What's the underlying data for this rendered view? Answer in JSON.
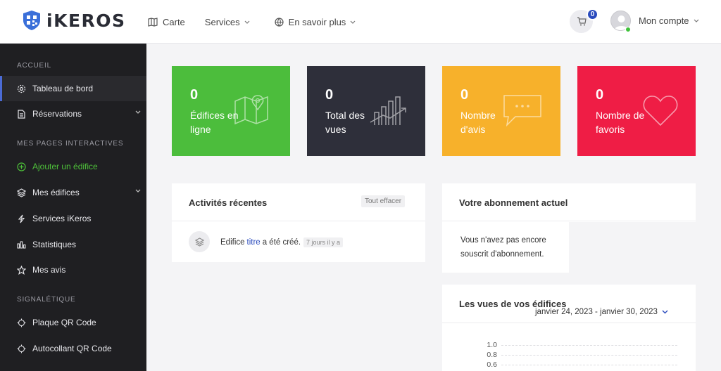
{
  "header": {
    "logo_text": "iKEROS",
    "nav": [
      {
        "label": "Carte",
        "icon": "map-icon"
      },
      {
        "label": "Services",
        "icon": ""
      },
      {
        "label": "En savoir plus",
        "icon": "globe-icon"
      }
    ],
    "cart_count": "0",
    "account_label": "Mon compte"
  },
  "sidebar": {
    "sections": [
      "ACCUEIL",
      "MES PAGES INTERACTIVES",
      "SIGNALÉTIQUE"
    ],
    "items": [
      {
        "label": "Tableau de bord",
        "icon": "gear-icon"
      },
      {
        "label": "Réservations",
        "icon": "document-icon"
      },
      {
        "label": "Ajouter un édifice",
        "icon": "plus-circle-icon"
      },
      {
        "label": "Mes édifices",
        "icon": "layers-icon"
      },
      {
        "label": "Services iKeros",
        "icon": "bolt-icon"
      },
      {
        "label": "Statistiques",
        "icon": "bar-chart-icon"
      },
      {
        "label": "Mes avis",
        "icon": "star-icon"
      },
      {
        "label": "Plaque QR Code",
        "icon": "crosshair-icon"
      },
      {
        "label": "Autocollant QR Code",
        "icon": "crosshair-icon"
      }
    ]
  },
  "cards": [
    {
      "value": "0",
      "label": "Édifices en ligne",
      "color": "#4cbd3c",
      "icon": "map-pin-icon"
    },
    {
      "value": "0",
      "label": "Total des vues",
      "color": "#2e2f3a",
      "icon": "growth-chart-icon"
    },
    {
      "value": "0",
      "label": "Nombre d'avis",
      "color": "#f7b12b",
      "icon": "speech-bubble-icon"
    },
    {
      "value": "0",
      "label": "Nombre de favoris",
      "color": "#ef1d45",
      "icon": "heart-icon"
    }
  ],
  "activities": {
    "title": "Activités récentes",
    "clear_label": "Tout effacer",
    "item": {
      "prefix": "Edifice",
      "link": "titre",
      "suffix": "a été créé.",
      "time": "7 jours il y a"
    }
  },
  "subscription": {
    "title": "Votre abonnement actuel",
    "text": "Vous n'avez pas encore souscrit d'abonnement."
  },
  "views": {
    "title": "Les vues de vos édifices",
    "date_range": "janvier 24, 2023 - janvier 30, 2023"
  },
  "chart_data": {
    "type": "line",
    "title": "Les vues de vos édifices",
    "y_ticks": [
      "1.0",
      "0.8",
      "0.6"
    ],
    "series": []
  }
}
